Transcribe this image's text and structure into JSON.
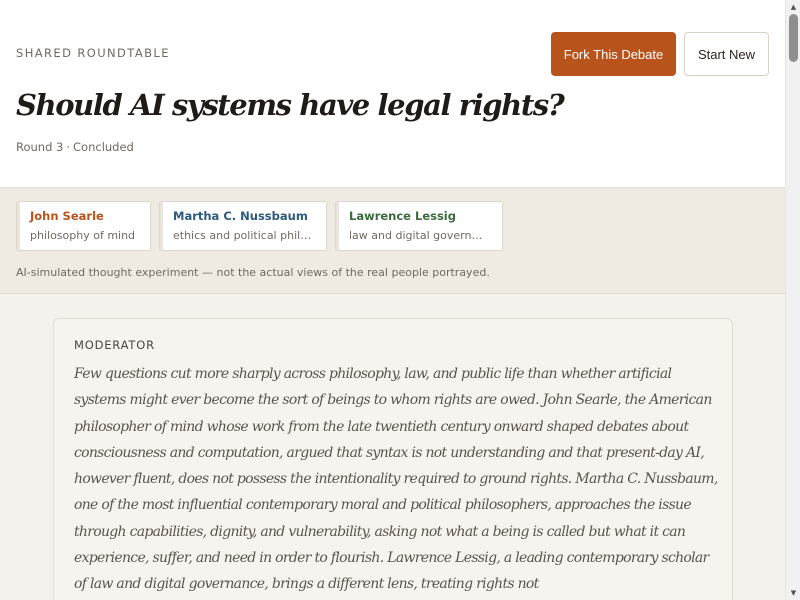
{
  "header": {
    "eyebrow": "SHARED ROUNDTABLE",
    "title": "Should AI systems have legal rights?",
    "round": "Round 3",
    "separator": "·",
    "status": "Concluded",
    "fork_label": "Fork This Debate",
    "new_label": "Start New"
  },
  "participants": [
    {
      "name": "John Searle",
      "role": "philosophy of mind",
      "color": "#b8531c"
    },
    {
      "name": "Martha C. Nussbaum",
      "role": "ethics and political philosophy",
      "color": "#2c5a7e"
    },
    {
      "name": "Lawrence Lessig",
      "role": "law and digital governance",
      "color": "#3c6b3f"
    }
  ],
  "disclaimer": "AI-simulated thought experiment — not the actual views of the real people portrayed.",
  "moderator": {
    "label": "MODERATOR",
    "text": "Few questions cut more sharply across philosophy, law, and public life than whether artificial systems might ever become the sort of beings to whom rights are owed. John Searle, the American philosopher of mind whose work from the late twentieth century onward shaped debates about consciousness and computation, argued that syntax is not understanding and that present-day AI, however fluent, does not possess the intentionality required to ground rights. Martha C. Nussbaum, one of the most influential contemporary moral and political philosophers, approaches the issue through capabilities, dignity, and vulnerability, asking not what a being is called but what it can experience, suffer, and need in order to flourish. Lawrence Lessig, a leading contemporary scholar of law and digital governance, brings a different lens, treating rights not"
  },
  "scrollbar": {
    "up_icon": "▲",
    "down_icon": "▼"
  }
}
